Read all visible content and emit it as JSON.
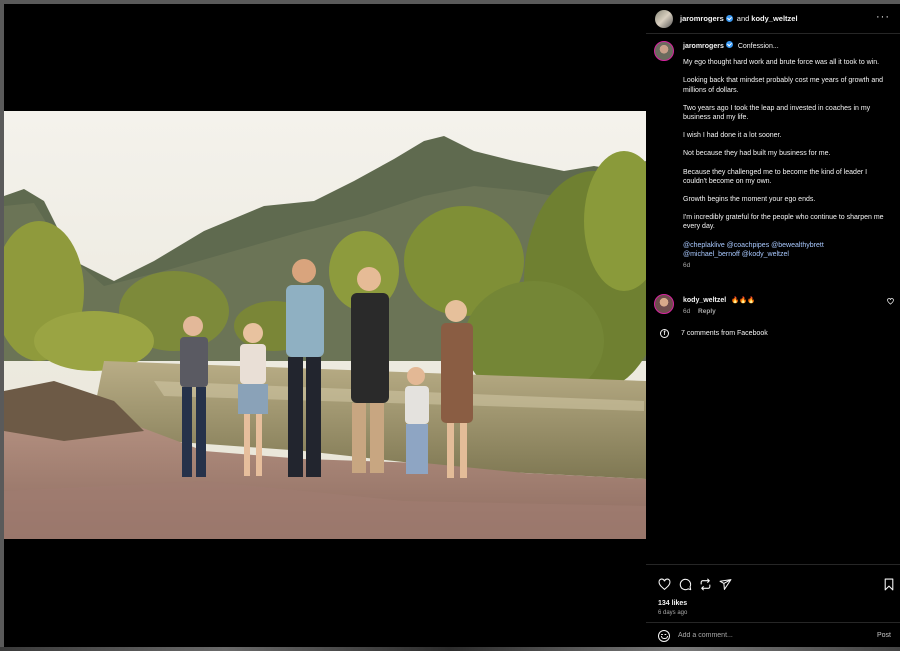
{
  "post": {
    "author": "jaromrogers",
    "collab_conj": "and",
    "collaborator": "kody_weltzel",
    "caption_head": "Confession...",
    "caption_paragraphs": [
      "My ego thought hard work and brute force was all it took to win.",
      "Looking back that mindset probably cost me years of growth and millions of dollars.",
      "Two years ago I took the leap and invested in coaches in my business and my life.",
      "I wish I had done it a lot sooner.",
      "Not because they had built my business for me.",
      "Because they challenged me to become the kind of leader I couldn't become on my own.",
      "Growth begins the moment your ego ends.",
      "I'm incredibly grateful for the people who continue to sharpen me every day."
    ],
    "mentions_line1": "@cheplaklive @coachpipes @bewealthybrett",
    "mentions_line2": "@michael_bernoff @kody_weltzel",
    "caption_time": "6d"
  },
  "comment": {
    "author": "kody_weltzel",
    "text": "🔥🔥🔥",
    "time": "6d",
    "reply_label": "Reply"
  },
  "facebook": {
    "label": "7 comments from Facebook",
    "icon": "facebook-icon"
  },
  "engagement": {
    "likes": "134 likes",
    "date": "6 days ago"
  },
  "composer": {
    "placeholder": "Add a comment...",
    "post_label": "Post"
  },
  "colors": {
    "background": "#000000",
    "verified": "#3897f0",
    "mention": "#a9c9ff",
    "muted": "#a8a8a8"
  }
}
